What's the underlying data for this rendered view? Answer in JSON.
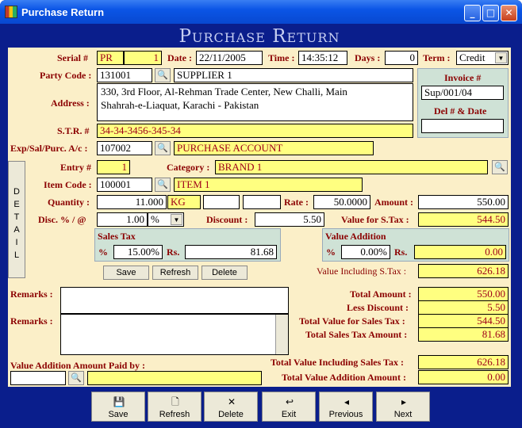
{
  "window": {
    "title": "Purchase Return"
  },
  "banner": "Purchase Return",
  "header": {
    "serial_label": "Serial #",
    "serial_prefix": "PR",
    "serial_no": "1",
    "date_label": "Date :",
    "date": "22/11/2005",
    "time_label": "Time :",
    "time": "14:35:12",
    "days_label": "Days :",
    "days": "0",
    "term_label": "Term :",
    "term": "Credit"
  },
  "party": {
    "code_label": "Party Code :",
    "code": "131001",
    "name": "SUPPLIER 1",
    "address_label": "Address :",
    "address_line1": "330, 3rd Floor, Al-Rehman Trade Center, New Challi, Main",
    "address_line2": "Shahrah-e-Liaquat, Karachi - Pakistan",
    "str_label": "S.T.R. #",
    "str": "34-34-3456-345-34",
    "acc_label": "Exp/Sal/Purc. A/c :",
    "acc_code": "107002",
    "acc_name": "PURCHASE ACCOUNT"
  },
  "invoice": {
    "label": "Invoice #",
    "value": "Sup/001/04",
    "del_label": "Del # & Date",
    "del_value": ""
  },
  "detail": {
    "tab": "DETAIL",
    "entry_label": "Entry #",
    "entry": "1",
    "category_label": "Category :",
    "category": "BRAND 1",
    "item_label": "Item Code :",
    "item_code": "100001",
    "item_name": "ITEM 1",
    "qty_label": "Quantity :",
    "qty": "11.000",
    "unit": "KG",
    "rate_label": "Rate :",
    "rate": "50.0000",
    "amount_label": "Amount :",
    "amount": "550.00",
    "disc_label": "Disc. % / @",
    "disc": "1.00",
    "disc_type": "%",
    "discount_label": "Discount :",
    "discount": "5.50",
    "vst_label": "Value for S.Tax :",
    "vst": "544.50",
    "salestax_title": "Sales Tax",
    "st_pct_label": "%",
    "st_pct": "15.00%",
    "st_rs_label": "Rs.",
    "st_rs": "81.68",
    "va_title": "Value Addition",
    "va_pct_label": "%",
    "va_pct": "0.00%",
    "va_rs_label": "Rs.",
    "va_rs": "0.00",
    "vinc_label": "Value Including S.Tax :",
    "vinc": "626.18",
    "save": "Save",
    "refresh": "Refresh",
    "delete": "Delete"
  },
  "remarks": {
    "label1": "Remarks :",
    "label2": "Remarks :",
    "value1": "",
    "value2": ""
  },
  "totals": {
    "total_amount_label": "Total Amount :",
    "total_amount": "550.00",
    "less_discount_label": "Less Discount :",
    "less_discount": "5.50",
    "tv_sales_tax_label": "Total Value for Sales Tax :",
    "tv_sales_tax": "544.50",
    "ts_tax_label": "Total Sales Tax Amount :",
    "ts_tax": "81.68",
    "tv_inc_label": "Total Value Including Sales Tax :",
    "tv_inc": "626.18",
    "tva_label": "Total Value Addition Amount :",
    "tva": "0.00"
  },
  "vapaid": {
    "label": "Value Addition Amount Paid by :",
    "code": "",
    "name": ""
  },
  "buttons": {
    "save": "Save",
    "refresh": "Refresh",
    "delete": "Delete",
    "exit": "Exit",
    "previous": "Previous",
    "next": "Next"
  },
  "icons": {
    "search": "search-icon",
    "save": "floppy-icon",
    "refresh": "document-icon",
    "delete": "x-icon",
    "exit": "exit-icon",
    "previous": "left-arrow-icon",
    "next": "right-arrow-icon"
  }
}
